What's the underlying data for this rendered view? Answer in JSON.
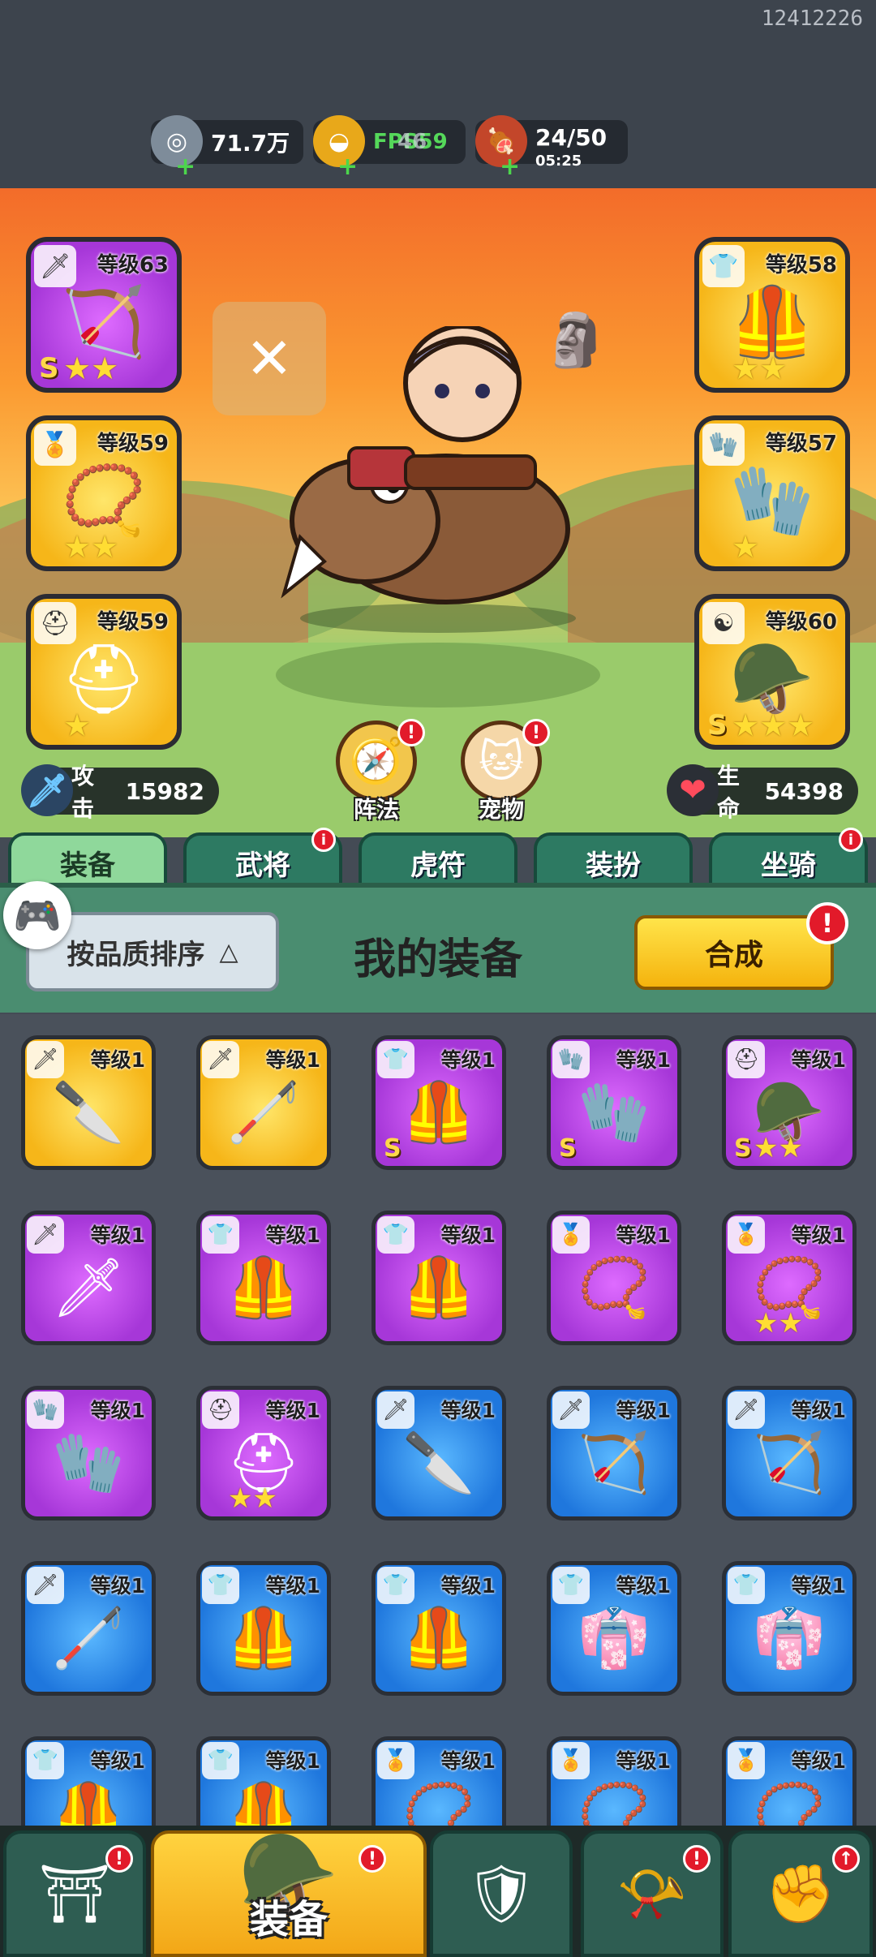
{
  "build_id": "12412226",
  "resources": {
    "silver": {
      "value": "71.7万",
      "icon": "silver-coin-icon"
    },
    "gold": {
      "value": "FPS59",
      "overlay": "46",
      "icon": "gold-ingot-icon"
    },
    "stamina": {
      "value": "24/50",
      "timer": "05:25",
      "icon": "meat-icon"
    }
  },
  "equipped_left": [
    {
      "level": "等级63",
      "color": "purple",
      "art": "🏹",
      "badge": "🗡",
      "stars": "★★",
      "rank": "S"
    },
    {
      "level": "等级59",
      "color": "gold",
      "art": "📿",
      "badge": "🏅",
      "stars": "★★",
      "rank": ""
    },
    {
      "level": "等级59",
      "color": "gold",
      "art": "⛑",
      "badge": "⛑",
      "stars": "★",
      "rank": ""
    }
  ],
  "equipped_right": [
    {
      "level": "等级58",
      "color": "gold",
      "art": "🦺",
      "badge": "👕",
      "stars": "★★",
      "rank": ""
    },
    {
      "level": "等级57",
      "color": "gold",
      "art": "🧤",
      "badge": "🧤",
      "stars": "★",
      "rank": ""
    },
    {
      "level": "等级60",
      "color": "gold",
      "art": "🪖",
      "badge": "☯",
      "stars": "★★★",
      "rank": "S"
    }
  ],
  "stats": {
    "attack_label": "攻击",
    "attack_value": "15982",
    "hp_label": "生命",
    "hp_value": "54398"
  },
  "round_buttons": {
    "formation": "阵法",
    "pet": "宠物"
  },
  "tabs": [
    "装备",
    "武将",
    "虎符",
    "装扮",
    "坐骑"
  ],
  "panel": {
    "sort_label": "按品质排序",
    "title": "我的装备",
    "synth_label": "合成"
  },
  "inventory": [
    {
      "level": "等级1",
      "color": "gold",
      "art": "🔪",
      "badge": "🗡",
      "stars": "",
      "rank": ""
    },
    {
      "level": "等级1",
      "color": "gold",
      "art": "🦯",
      "badge": "🗡",
      "stars": "",
      "rank": ""
    },
    {
      "level": "等级1",
      "color": "purple",
      "art": "🦺",
      "badge": "👕",
      "stars": "",
      "rank": "S"
    },
    {
      "level": "等级1",
      "color": "purple",
      "art": "🧤",
      "badge": "🧤",
      "stars": "",
      "rank": "S"
    },
    {
      "level": "等级1",
      "color": "purple",
      "art": "🪖",
      "badge": "⛑",
      "stars": "★★",
      "rank": "S"
    },
    {
      "level": "等级1",
      "color": "purple",
      "art": "🗡",
      "badge": "🗡",
      "stars": "",
      "rank": ""
    },
    {
      "level": "等级1",
      "color": "purple",
      "art": "🦺",
      "badge": "👕",
      "stars": "",
      "rank": ""
    },
    {
      "level": "等级1",
      "color": "purple",
      "art": "🦺",
      "badge": "👕",
      "stars": "",
      "rank": ""
    },
    {
      "level": "等级1",
      "color": "purple",
      "art": "📿",
      "badge": "🏅",
      "stars": "",
      "rank": ""
    },
    {
      "level": "等级1",
      "color": "purple",
      "art": "📿",
      "badge": "🏅",
      "stars": "★★",
      "rank": ""
    },
    {
      "level": "等级1",
      "color": "purple",
      "art": "🧤",
      "badge": "🧤",
      "stars": "",
      "rank": ""
    },
    {
      "level": "等级1",
      "color": "purple",
      "art": "⛑",
      "badge": "⛑",
      "stars": "★★",
      "rank": ""
    },
    {
      "level": "等级1",
      "color": "blue",
      "art": "🔪",
      "badge": "🗡",
      "stars": "",
      "rank": ""
    },
    {
      "level": "等级1",
      "color": "blue",
      "art": "🏹",
      "badge": "🗡",
      "stars": "",
      "rank": ""
    },
    {
      "level": "等级1",
      "color": "blue",
      "art": "🏹",
      "badge": "🗡",
      "stars": "",
      "rank": ""
    },
    {
      "level": "等级1",
      "color": "blue",
      "art": "🦯",
      "badge": "🗡",
      "stars": "",
      "rank": ""
    },
    {
      "level": "等级1",
      "color": "blue",
      "art": "🦺",
      "badge": "👕",
      "stars": "",
      "rank": ""
    },
    {
      "level": "等级1",
      "color": "blue",
      "art": "🦺",
      "badge": "👕",
      "stars": "",
      "rank": ""
    },
    {
      "level": "等级1",
      "color": "blue",
      "art": "👘",
      "badge": "👕",
      "stars": "",
      "rank": ""
    },
    {
      "level": "等级1",
      "color": "blue",
      "art": "👘",
      "badge": "👕",
      "stars": "",
      "rank": ""
    },
    {
      "level": "等级1",
      "color": "blue",
      "art": "🦺",
      "badge": "👕",
      "stars": "",
      "rank": ""
    },
    {
      "level": "等级1",
      "color": "blue",
      "art": "🦺",
      "badge": "👕",
      "stars": "",
      "rank": ""
    },
    {
      "level": "等级1",
      "color": "blue",
      "art": "📿",
      "badge": "🏅",
      "stars": "",
      "rank": ""
    },
    {
      "level": "等级1",
      "color": "blue",
      "art": "📿",
      "badge": "🏅",
      "stars": "",
      "rank": ""
    },
    {
      "level": "等级1",
      "color": "blue",
      "art": "📿",
      "badge": "🏅",
      "stars": "",
      "rank": ""
    }
  ],
  "bottom_nav": [
    {
      "name": "gate-icon",
      "art": "⛩",
      "label": "",
      "alert": "!"
    },
    {
      "name": "helmet-icon",
      "art": "🪖",
      "label": "装备",
      "alert": "!"
    },
    {
      "name": "shield-sword-icon",
      "art": "🛡",
      "label": "",
      "alert": ""
    },
    {
      "name": "horn-icon",
      "art": "📯",
      "label": "",
      "alert": "!"
    },
    {
      "name": "fist-icon",
      "art": "✊",
      "label": "",
      "alert": "↑"
    }
  ],
  "alert_mark": "!"
}
